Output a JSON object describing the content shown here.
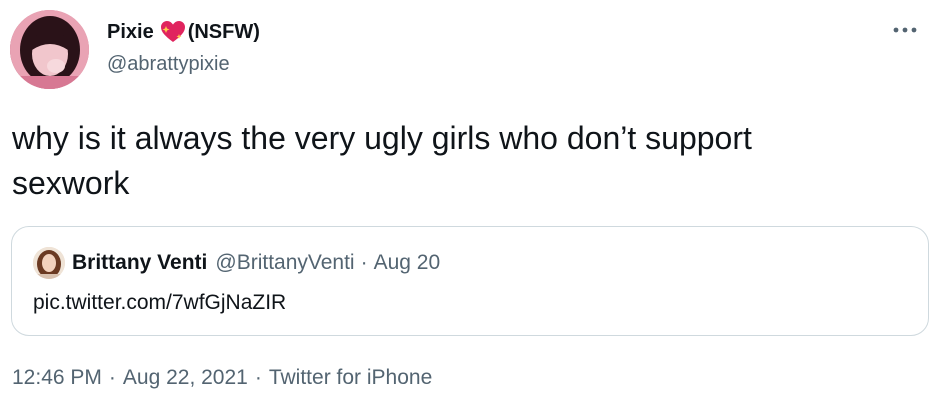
{
  "tweet": {
    "author": {
      "display_name": "Pixie",
      "name_suffix": "(NSFW)",
      "name_emoji": "heart-sparkle-icon",
      "handle": "@abrattypixie"
    },
    "more_icon": "more-dots-icon",
    "text": "why is it always the very ugly girls who don’t support\nsexwork",
    "quoted": {
      "display_name": "Brittany Venti",
      "handle": "@BrittanyVenti",
      "separator": "·",
      "date": "Aug 20",
      "link": "pic.twitter.com/7wfGjNaZIR"
    },
    "meta": {
      "time": "12:46 PM",
      "separator1": "·",
      "date": "Aug 22, 2021",
      "separator2": "·",
      "source": "Twitter for iPhone"
    }
  },
  "colors": {
    "text_primary": "#0f1419",
    "text_secondary": "#536471",
    "border": "#cfd9de",
    "heart": "#e0245e"
  }
}
